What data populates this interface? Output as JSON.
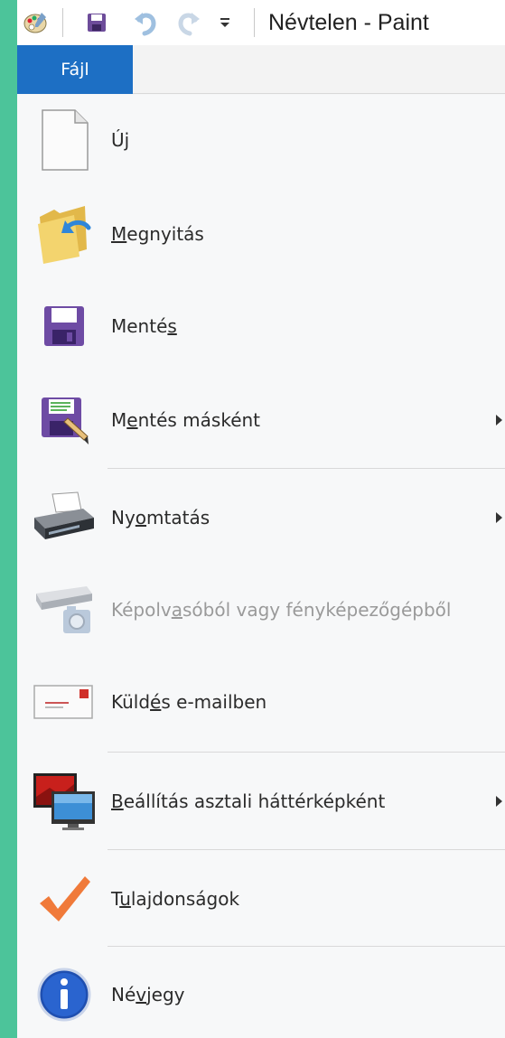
{
  "window": {
    "title": "Névtelen - Paint"
  },
  "ribbon": {
    "file_tab": "Fájl"
  },
  "menu": {
    "items": [
      {
        "pre": "Ú",
        "key": "j",
        "post": "",
        "submenu": false,
        "enabled": true,
        "icon": "new-document-icon"
      },
      {
        "pre": "",
        "key": "M",
        "post": "egnyitás",
        "submenu": false,
        "enabled": true,
        "icon": "open-folder-icon"
      },
      {
        "pre": "Menté",
        "key": "s",
        "post": "",
        "submenu": false,
        "enabled": true,
        "icon": "save-disk-icon"
      },
      {
        "pre": "M",
        "key": "e",
        "post": "ntés másként",
        "submenu": true,
        "enabled": true,
        "icon": "save-as-icon"
      },
      {
        "pre": "Ny",
        "key": "o",
        "post": "mtatás",
        "submenu": true,
        "enabled": true,
        "icon": "printer-icon"
      },
      {
        "pre": "Képolv",
        "key": "a",
        "post": "sóból vagy fényképezőgépből",
        "submenu": false,
        "enabled": false,
        "icon": "scanner-camera-icon"
      },
      {
        "pre": "Küld",
        "key": "é",
        "post": "s e-mailben",
        "submenu": false,
        "enabled": true,
        "icon": "email-icon"
      },
      {
        "pre": "",
        "key": "B",
        "post": "eállítás asztali háttérképként",
        "submenu": true,
        "enabled": true,
        "icon": "desktop-background-icon"
      },
      {
        "pre": "T",
        "key": "u",
        "post": "lajdonságok",
        "submenu": false,
        "enabled": true,
        "icon": "checkmark-icon"
      },
      {
        "pre": "Né",
        "key": "v",
        "post": "jegy",
        "submenu": false,
        "enabled": true,
        "icon": "info-icon"
      }
    ]
  },
  "colors": {
    "desktop": "#4cc49a",
    "file_tab": "#1d6fc4",
    "menu_bg": "#f7f8f9"
  }
}
